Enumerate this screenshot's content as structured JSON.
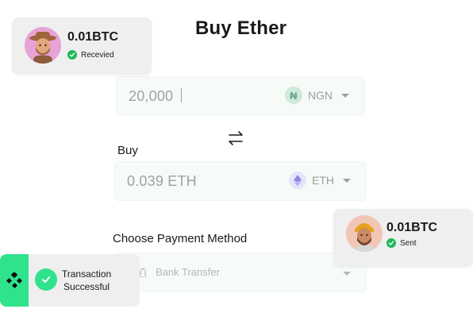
{
  "title": "Buy Ether",
  "pay": {
    "amount": "20,000",
    "currency": "NGN",
    "currency_symbol": "₦"
  },
  "buy": {
    "label": "Buy",
    "amount": "0.039 ETH",
    "currency": "ETH",
    "currency_symbol": "Ξ"
  },
  "payment_method": {
    "label": "Choose Payment Method",
    "selected": "Bank Transfer"
  },
  "notifications": [
    {
      "amount": "0.01BTC",
      "status": "Recevied"
    },
    {
      "amount": "0.01BTC",
      "status": "Sent"
    }
  ],
  "toast": {
    "line1": "Transaction",
    "line2": "Successful"
  },
  "colors": {
    "accent_green": "#2ee38c",
    "check_green": "#1fb85a",
    "naira_coin": "#cfe9da",
    "eth_coin": "#e6e4fb"
  },
  "icons": [
    "naira-icon",
    "eth-icon",
    "swap-arrows-icon",
    "bank-icon",
    "check-icon",
    "brand-logo-icon"
  ]
}
